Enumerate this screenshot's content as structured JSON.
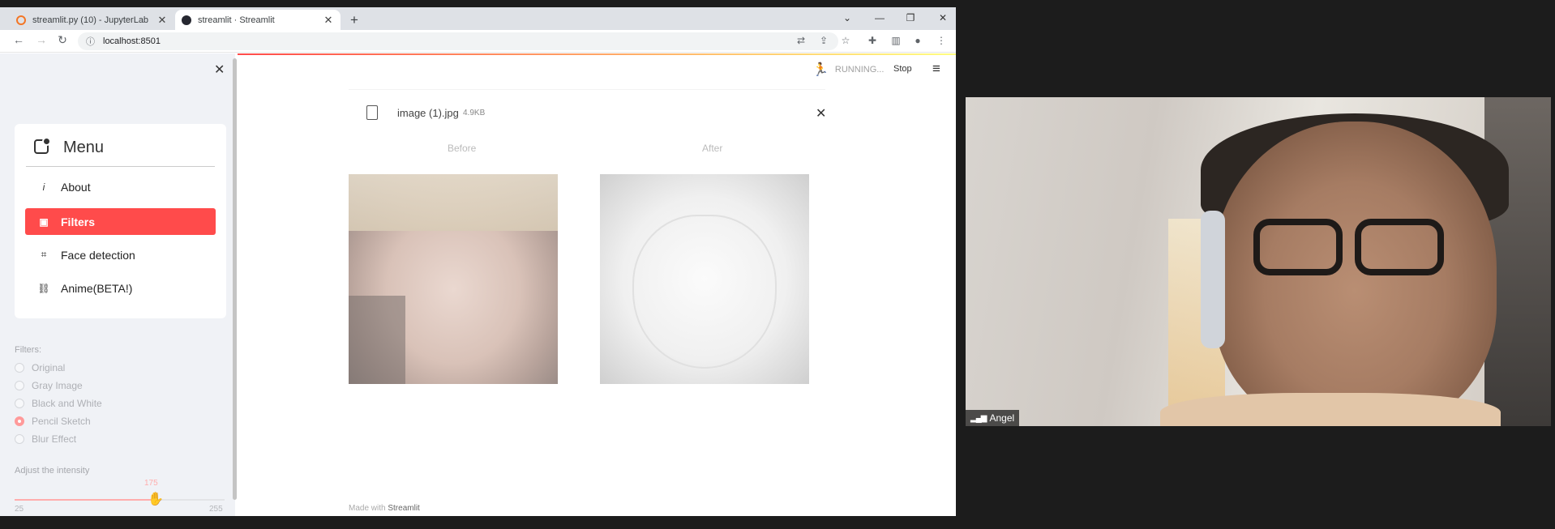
{
  "browser": {
    "tabs": [
      {
        "label": "streamlit.py (10) - JupyterLab",
        "favicon_color": "#f37626"
      },
      {
        "label": "streamlit · Streamlit",
        "favicon_color": "#262730"
      }
    ],
    "url": "localhost:8501"
  },
  "sidebar": {
    "menu_title": "Menu",
    "items": [
      {
        "label": "About",
        "icon": "info-icon"
      },
      {
        "label": "Filters",
        "icon": "image-icon"
      },
      {
        "label": "Face detection",
        "icon": "face-scan-icon"
      },
      {
        "label": "Anime(BETA!)",
        "icon": "link-icon"
      }
    ],
    "active_item": "Filters",
    "filters_label": "Filters:",
    "filters": [
      "Original",
      "Gray Image",
      "Black and White",
      "Pencil Sketch",
      "Blur Effect"
    ],
    "selected_filter": "Pencil Sketch",
    "slider": {
      "label": "Adjust the intensity",
      "value": "175",
      "min": "25",
      "max": "255",
      "fraction": 0.65
    }
  },
  "header": {
    "status": "RUNNING...",
    "stop_label": "Stop"
  },
  "main": {
    "file_name": "image (1).jpg",
    "file_size": "4.9KB",
    "before_caption": "Before",
    "after_caption": "After",
    "footer_prefix": "Made with",
    "footer_brand": "Streamlit"
  },
  "video": {
    "participant": "Angel"
  },
  "colors": {
    "accent": "#ff4b4b",
    "sidebar_bg": "#f0f2f6"
  }
}
